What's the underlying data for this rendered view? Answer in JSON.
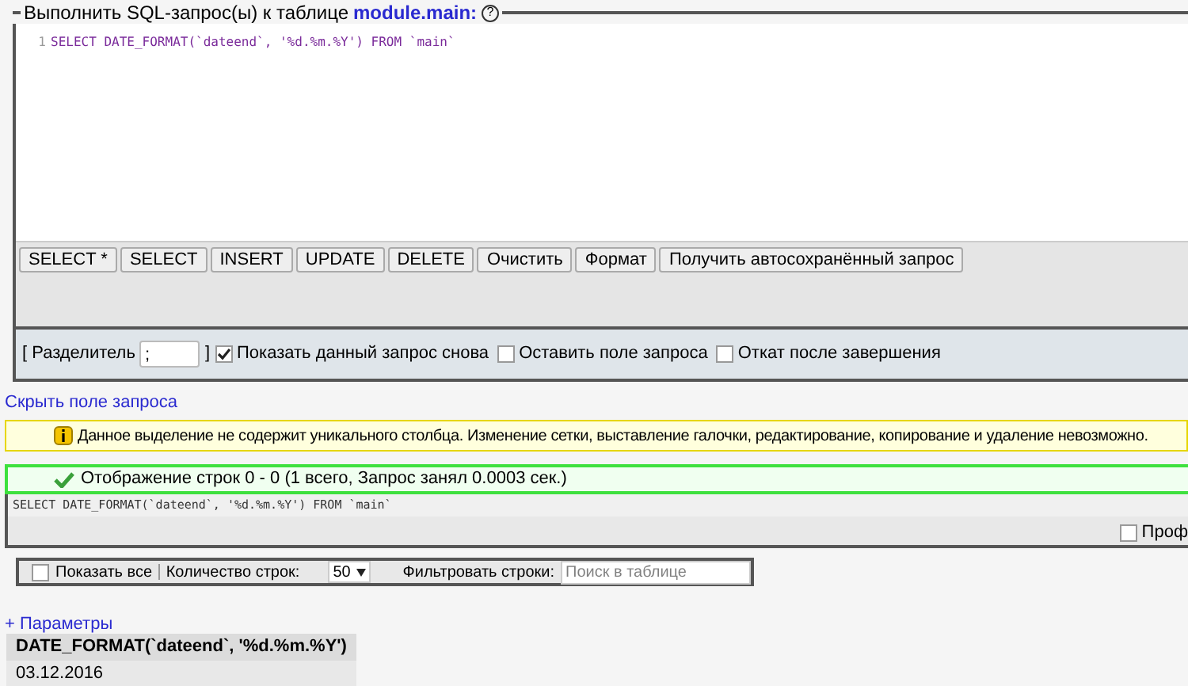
{
  "query_box": {
    "legend": "Выполнить SQL-запрос(ы) к таблице",
    "table": "module.main:",
    "help": "?",
    "line_number": "1",
    "query": "SELECT DATE_FORMAT(`dateend`, '%d.%m.%Y') FROM `main`"
  },
  "buttons": [
    "SELECT *",
    "SELECT",
    "INSERT",
    "UPDATE",
    "DELETE",
    "Очистить",
    "Формат",
    "Получить автосохранённый запрос"
  ],
  "options": {
    "delimiter_label_open": "[ Разделитель",
    "delimiter_value": ";",
    "delimiter_label_close": "]",
    "checkboxes": [
      {
        "label": "Показать данный запрос снова",
        "checked": true
      },
      {
        "label": "Оставить поле запроса",
        "checked": false
      },
      {
        "label": "Откат после завершения",
        "checked": false
      }
    ]
  },
  "hide_link": "Скрыть поле запроса",
  "warning": "Данное выделение не содержит уникального столбца. Изменение сетки, выставление галочки, редактирование, копирование и удаление невозможно.",
  "success": "Отображение строк 0 - 0 (1 всего, Запрос занял 0.0003 сек.)",
  "result_query": "SELECT DATE_FORMAT(`dateend`, '%d.%m.%Y') FROM `main`",
  "profiling": {
    "label": "Проф",
    "checked": false
  },
  "nav": {
    "show_all": {
      "label": "Показать все",
      "checked": false
    },
    "rows_label": "Количество строк:",
    "rows_value": "50",
    "filter_label": "Фильтровать строки:",
    "filter_placeholder": "Поиск в таблице"
  },
  "params_link": "+ Параметры",
  "table": {
    "columns": [
      "DATE_FORMAT(`dateend`, '%d.%m.%Y')"
    ],
    "rows": [
      [
        "03.12.2016"
      ]
    ]
  }
}
